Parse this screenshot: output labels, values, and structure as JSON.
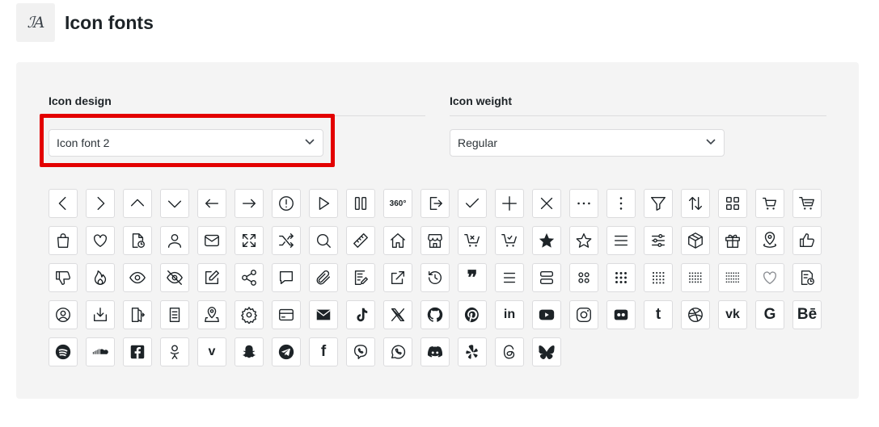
{
  "header": {
    "title": "Icon fonts",
    "icon": "font-icon"
  },
  "design": {
    "label": "Icon design",
    "value": "Icon font 2"
  },
  "weight": {
    "label": "Icon weight",
    "value": "Regular"
  },
  "icon_grid": {
    "rows": [
      [
        "chevron-left",
        "chevron-right",
        "chevron-up",
        "chevron-down",
        "arrow-left",
        "arrow-right",
        "alert-circle",
        "play",
        "pause-columns",
        "view-360",
        "logout",
        "check",
        "plus",
        "close",
        "more-horizontal",
        "more-vertical",
        "filter",
        "sort-arrows",
        "grid",
        "cart",
        "cart-alt"
      ],
      [
        "bag",
        "heart",
        "document-time",
        "user",
        "mail",
        "expand",
        "shuffle",
        "search",
        "ruler",
        "home",
        "store",
        "cart-remove",
        "cart-check",
        "star-filled",
        "star",
        "menu",
        "sliders",
        "box",
        "gift",
        "location-pin",
        "thumbs-up"
      ],
      [
        "thumbs-down",
        "fire",
        "eye",
        "eye-off",
        "edit",
        "share",
        "comment",
        "paperclip",
        "notes",
        "external-link",
        "history",
        "quote",
        "list",
        "rows",
        "grid-4",
        "grid-9",
        "grid-16",
        "grid-20",
        "grid-24",
        "heart-outline",
        "document-clock"
      ],
      [
        "user-circle",
        "download-box",
        "door-exit",
        "checklist",
        "map-pin",
        "settings",
        "credit-card",
        "envelope-filled",
        "tiktok",
        "x-twitter",
        "github",
        "pinterest",
        "linkedin",
        "youtube",
        "instagram",
        "flickr",
        "tumblr",
        "dribbble",
        "vk",
        "google",
        "behance"
      ],
      [
        "spotify",
        "soundcloud",
        "facebook-square",
        "odnoklassniki",
        "vimeo",
        "snapchat",
        "telegram",
        "facebook",
        "viber",
        "whatsapp",
        "discord",
        "yelp",
        "threads",
        "bluesky"
      ]
    ],
    "text_glyphs": {
      "view-360": "360°",
      "linkedin": "in",
      "tumblr": "t",
      "vk": "vk",
      "google": "G",
      "behance": "Bē",
      "facebook": "f",
      "vimeo": "v",
      "quote": "❞"
    }
  }
}
